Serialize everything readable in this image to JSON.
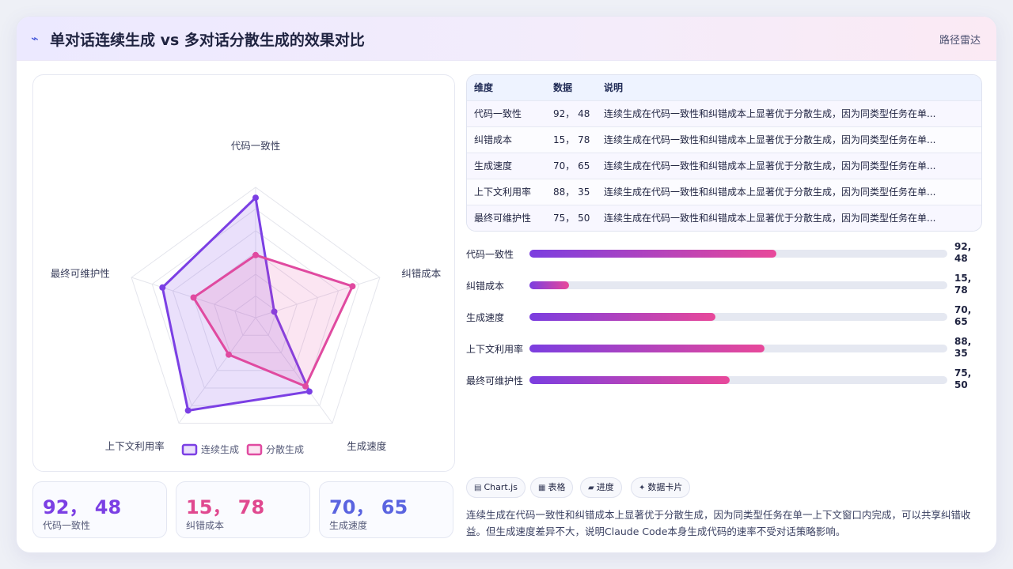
{
  "header": {
    "icon": "bolt-icon",
    "title": "单对话连续生成 vs 多对话分散生成的效果对比",
    "badge": "路径雷达"
  },
  "chart_data": {
    "type": "radar",
    "axes": [
      "代码一致性",
      "纠错成本",
      "生成速度",
      "上下文利用率",
      "最终可维护性"
    ],
    "range": [
      0,
      100
    ],
    "series": [
      {
        "name": "连续生成",
        "values": [
          92,
          15,
          70,
          88,
          75
        ],
        "color": "#7b3fe4"
      },
      {
        "name": "分散生成",
        "values": [
          48,
          78,
          65,
          35,
          50
        ],
        "color": "#e04aa0"
      }
    ],
    "legend_position": "bottom"
  },
  "kpis": [
    {
      "value": "92， 48",
      "label": "代码一致性",
      "color": "#7b3fe4"
    },
    {
      "value": "15， 78",
      "label": "纠错成本",
      "color": "#e0488f"
    },
    {
      "value": "70， 65",
      "label": "生成速度",
      "color": "#5a64e0"
    }
  ],
  "table": {
    "headers": [
      "维度",
      "数据",
      "说明"
    ],
    "rows": [
      [
        "代码一致性",
        "92， 48",
        "连续生成在代码一致性和纠错成本上显著优于分散生成，因为同类型任务在单..."
      ],
      [
        "纠错成本",
        "15， 78",
        "连续生成在代码一致性和纠错成本上显著优于分散生成，因为同类型任务在单..."
      ],
      [
        "生成速度",
        "70， 65",
        "连续生成在代码一致性和纠错成本上显著优于分散生成，因为同类型任务在单..."
      ],
      [
        "上下文利用率",
        "88， 35",
        "连续生成在代码一致性和纠错成本上显著优于分散生成，因为同类型任务在单..."
      ],
      [
        "最终可维护性",
        "75， 50",
        "连续生成在代码一致性和纠错成本上显著优于分散生成，因为同类型任务在单..."
      ]
    ]
  },
  "bars": [
    {
      "label": "代码一致性",
      "value_line1": "92,",
      "value_line2": "48",
      "fill": 0.59
    },
    {
      "label": "纠错成本",
      "value_line1": "15,",
      "value_line2": "78",
      "fill": 0.095
    },
    {
      "label": "生成速度",
      "value_line1": "70,",
      "value_line2": "65",
      "fill": 0.445
    },
    {
      "label": "上下文利用率",
      "value_line1": "88,",
      "value_line2": "35",
      "fill": 0.563
    },
    {
      "label": "最终可维护性",
      "value_line1": "75,",
      "value_line2": "50",
      "fill": 0.48
    }
  ],
  "tags": [
    {
      "icon": "chart-icon",
      "glyph": "▤",
      "label": "Chart.js"
    },
    {
      "icon": "table-icon",
      "glyph": "▦",
      "label": "表格"
    },
    {
      "icon": "progress-icon",
      "glyph": "▰",
      "label": "进度"
    },
    {
      "icon": "sparkle-icon",
      "glyph": "✦",
      "label": "数据卡片"
    }
  ],
  "summary": "连续生成在代码一致性和纠错成本上显著优于分散生成，因为同类型任务在单一上下文窗口内完成，可以共享纠错收益。但生成速度差异不大，说明Claude Code本身生成代码的速率不受对话策略影响。"
}
